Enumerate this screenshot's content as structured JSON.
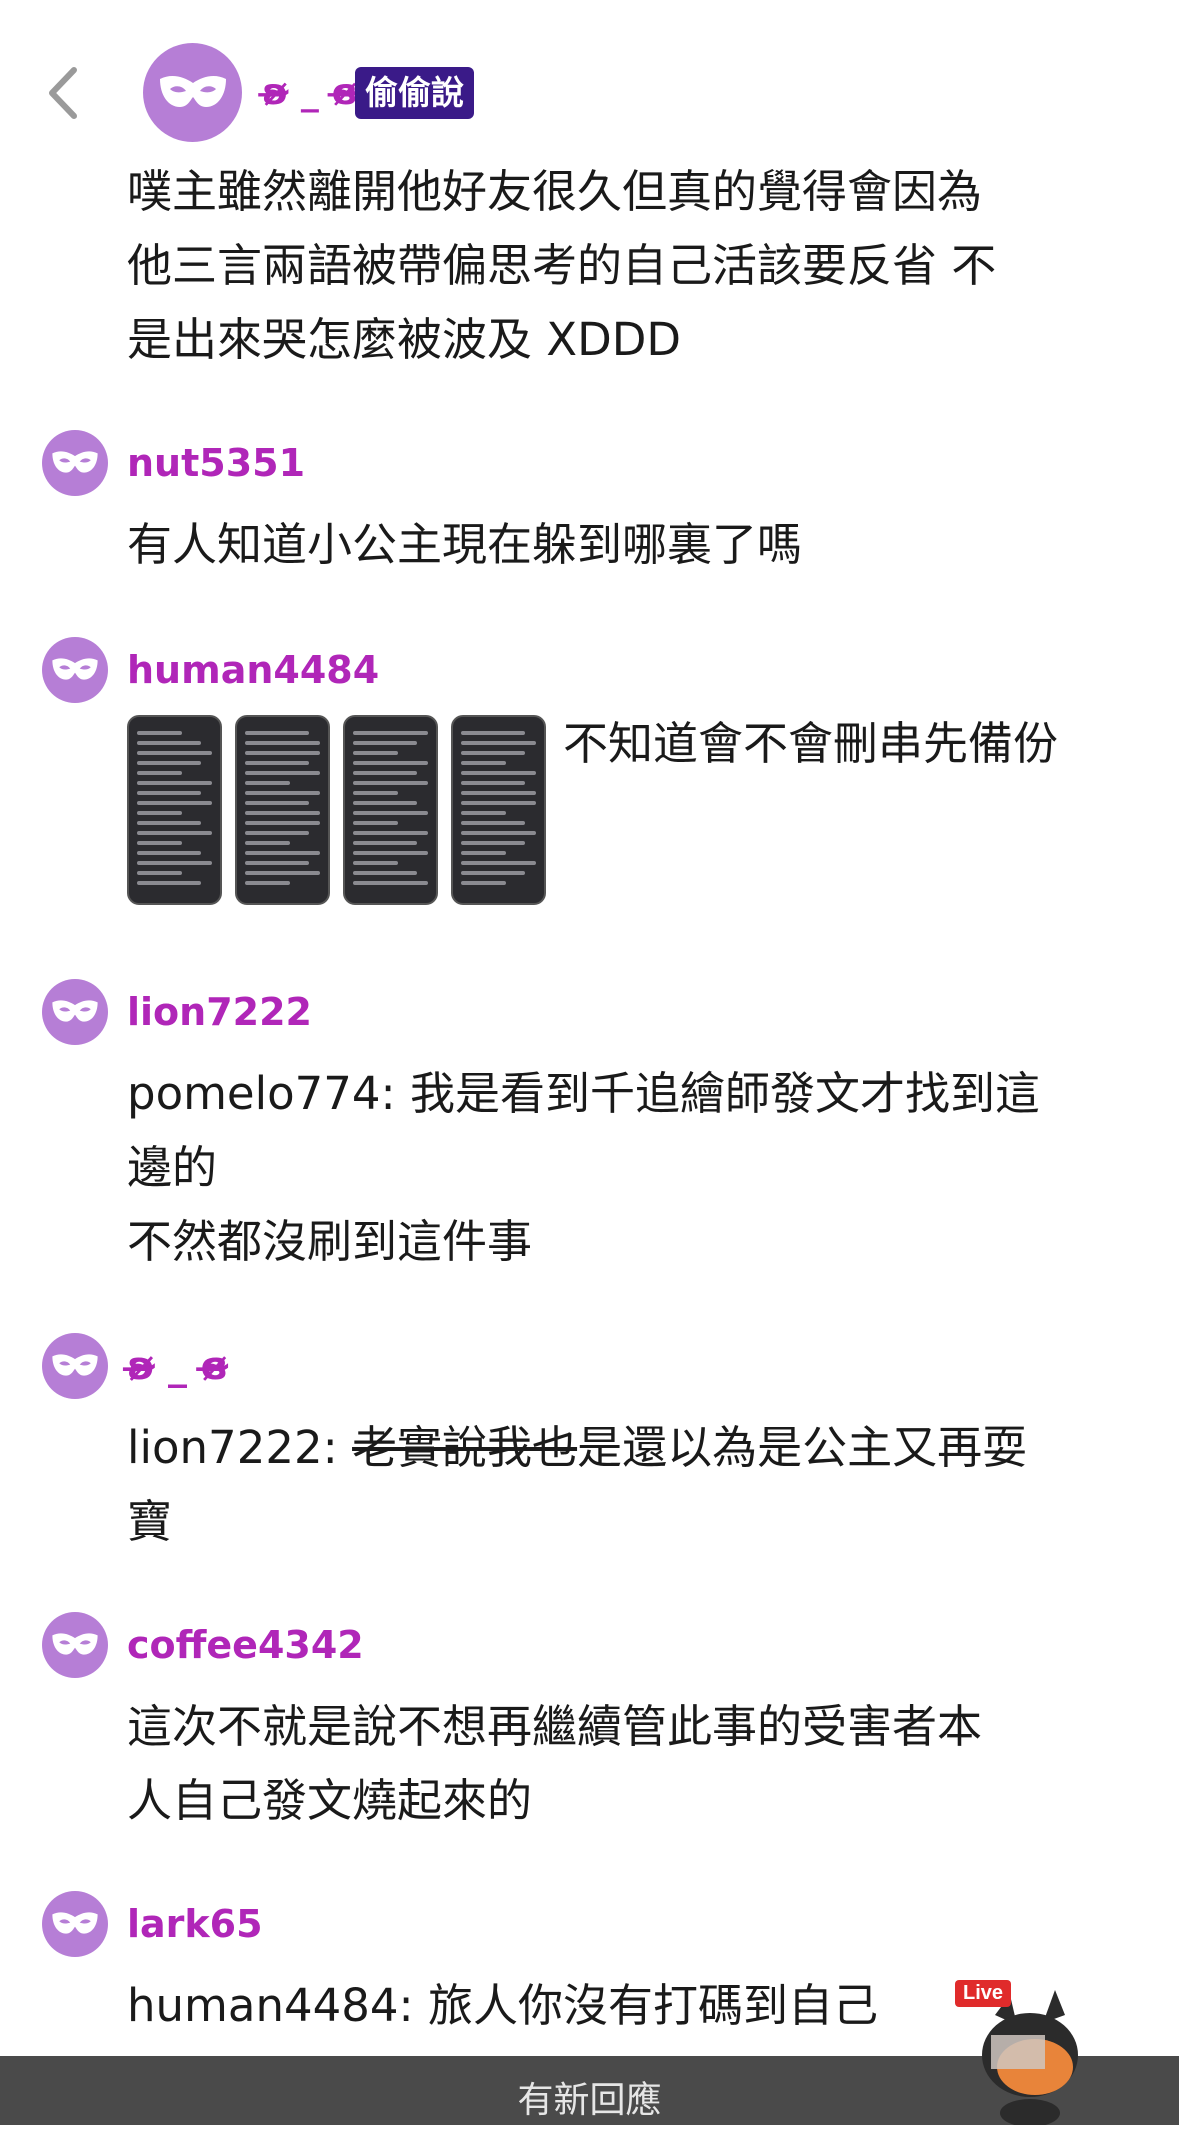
{
  "header": {
    "author": "ʚ̴̶̷̷ _ ɞ̴̶̷",
    "badge": "偷偷說",
    "post_text": "噗主雖然離開他好友很久但真的覺得會因為\n他三言兩語被帶偏思考的自己活該要反省 不\n是出來哭怎麼被波及 XDDD"
  },
  "responses": [
    {
      "name": "nut5351",
      "text": "有人知道小公主現在躲到哪裏了嗎"
    },
    {
      "name": "human4484",
      "caption": "不知道會不會刪串先備份",
      "thumbnail_count": 4
    },
    {
      "name": "lion7222",
      "text": "pomelo774: 我是看到千追繪師發文才找到這\n邊的\n不然都沒刷到這件事"
    },
    {
      "name": "ʚ̴̶̷̷ _ ɞ̴̶̷",
      "prefix": "lion7222: ",
      "struck": "老實說我也",
      "rest": "是還以為是公主又再耍\n寶"
    },
    {
      "name": "coffee4342",
      "text": "這次不就是說不想再繼續管此事的受害者本\n人自己發文燒起來的"
    },
    {
      "name": "lark65",
      "text": "human4484: 旅人你沒有打碼到自己"
    }
  ],
  "new_reply_bar": "有新回應",
  "sticker": {
    "label": "Live"
  },
  "colors": {
    "username": "#b026b8",
    "avatar_bg": "#b67ed6",
    "badge_bg": "#3a1a88",
    "bottom_bar": "#4a4a4a"
  },
  "icons": {
    "back": "chevron-left-icon",
    "avatar": "mask-icon"
  }
}
